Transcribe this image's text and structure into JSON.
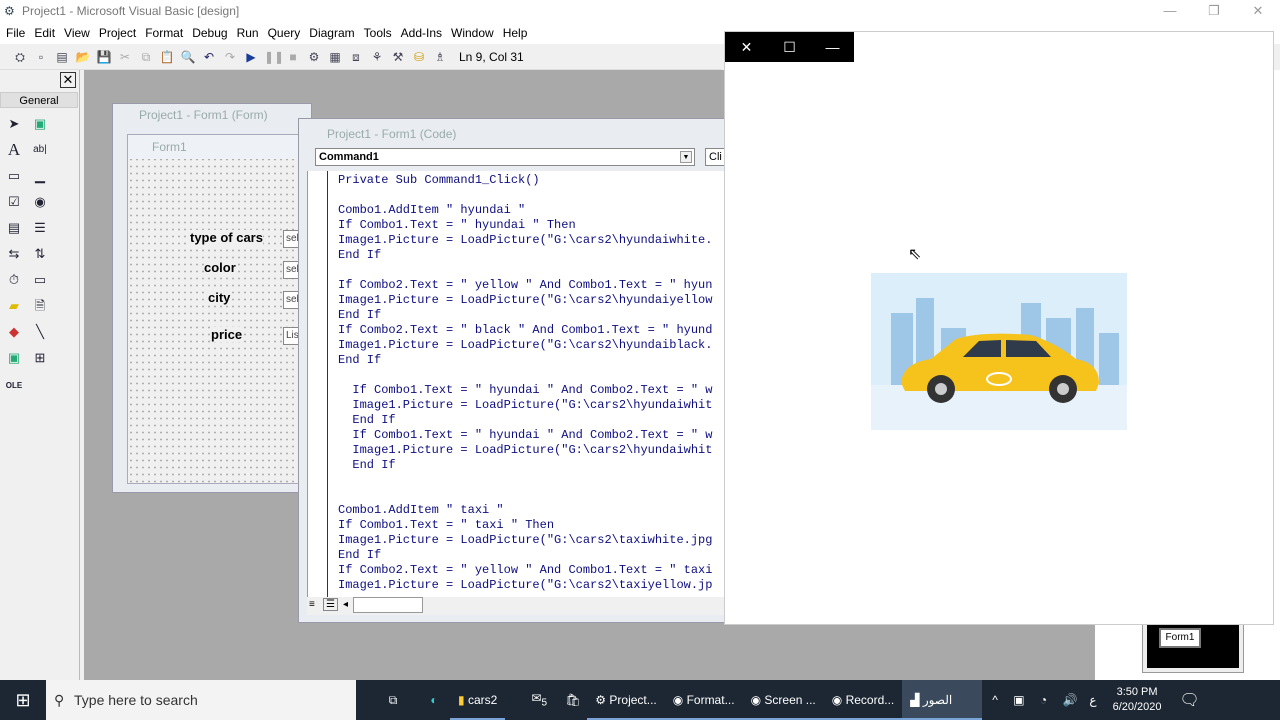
{
  "window": {
    "title": "Project1 - Microsoft Visual Basic [design]"
  },
  "menu": [
    "File",
    "Edit",
    "View",
    "Project",
    "Format",
    "Debug",
    "Run",
    "Query",
    "Diagram",
    "Tools",
    "Add-Ins",
    "Window",
    "Help"
  ],
  "toolbar": {
    "position": "Ln 9, Col 31"
  },
  "toolbox": {
    "title": "General"
  },
  "form_window": {
    "title": "Project1 - Form1 (Form)",
    "form_title": "Form1",
    "labels": [
      "type of cars",
      "color",
      "city",
      "price"
    ],
    "combos": [
      "sel",
      "sel",
      "sel",
      "Lis"
    ]
  },
  "code_window": {
    "title": "Project1 - Form1 (Code)",
    "object": "Command1",
    "procedure": "Cli",
    "lines": [
      "Private Sub Command1_Click()",
      "",
      "Combo1.AddItem \" hyundai \"",
      "If Combo1.Text = \" hyundai \" Then",
      "Image1.Picture = LoadPicture(\"G:\\cars2\\hyundaiwhite.",
      "End If",
      "",
      "If Combo2.Text = \" yellow \" And Combo1.Text = \" hyun",
      "Image1.Picture = LoadPicture(\"G:\\cars2\\hyundaiyellow",
      "End If",
      "If Combo2.Text = \" black \" And Combo1.Text = \" hyund",
      "Image1.Picture = LoadPicture(\"G:\\cars2\\hyundaiblack.",
      "End If",
      "",
      "  If Combo1.Text = \" hyundai \" And Combo2.Text = \" w",
      "  Image1.Picture = LoadPicture(\"G:\\cars2\\hyundaiwhit",
      "  End If",
      "  If Combo1.Text = \" hyundai \" And Combo2.Text = \" w",
      "  Image1.Picture = LoadPicture(\"G:\\cars2\\hyundaiwhit",
      "  End If",
      "",
      "",
      "Combo1.AddItem \" taxi \"",
      "If Combo1.Text = \" taxi \" Then",
      "Image1.Picture = LoadPicture(\"G:\\cars2\\taxiwhite.jpg",
      "End If",
      "If Combo2.Text = \" yellow \" And Combo1.Text = \" taxi",
      "Image1.Picture = LoadPicture(\"G:\\cars2\\taxiyellow.jp"
    ]
  },
  "run_window": {
    "close": "✕",
    "maximize": "☐",
    "minimize": "—"
  },
  "project_preview": {
    "label": "Form1"
  },
  "taskbar": {
    "search_placeholder": "Type here to search",
    "mail_badge": "5",
    "items": [
      "cars2",
      "Project...",
      "Format...",
      "Screen ...",
      "Record...",
      "الصور"
    ],
    "lang": "ع",
    "time": "3:50 PM",
    "date": "6/20/2020"
  }
}
